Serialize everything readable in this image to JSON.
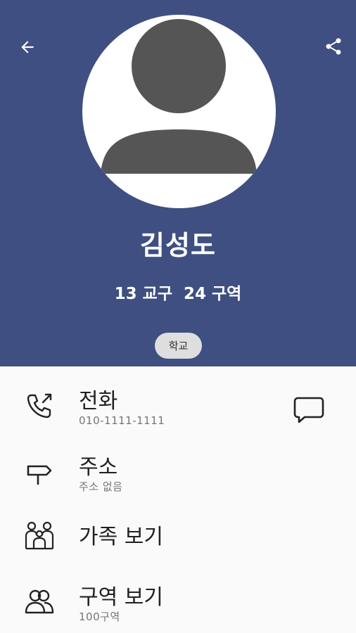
{
  "header": {
    "back_icon": "arrow-back-icon",
    "share_icon": "share-icon",
    "background_color": "#3f4f81",
    "avatar_icon": "person-placeholder-icon"
  },
  "profile": {
    "name": "김성도",
    "district": "13 교구  24 구역",
    "tag": "학교"
  },
  "rows": [
    {
      "title": "전화",
      "subtitle": "010-1111-1111",
      "icon": "phone-call-icon",
      "action_icon": "chat-bubble-icon"
    },
    {
      "title": "주소",
      "subtitle": "주소 없음",
      "icon": "signpost-icon"
    },
    {
      "title": "가족 보기",
      "icon": "family-icon"
    },
    {
      "title": "구역 보기",
      "subtitle": "100구역",
      "icon": "group-icon"
    }
  ]
}
